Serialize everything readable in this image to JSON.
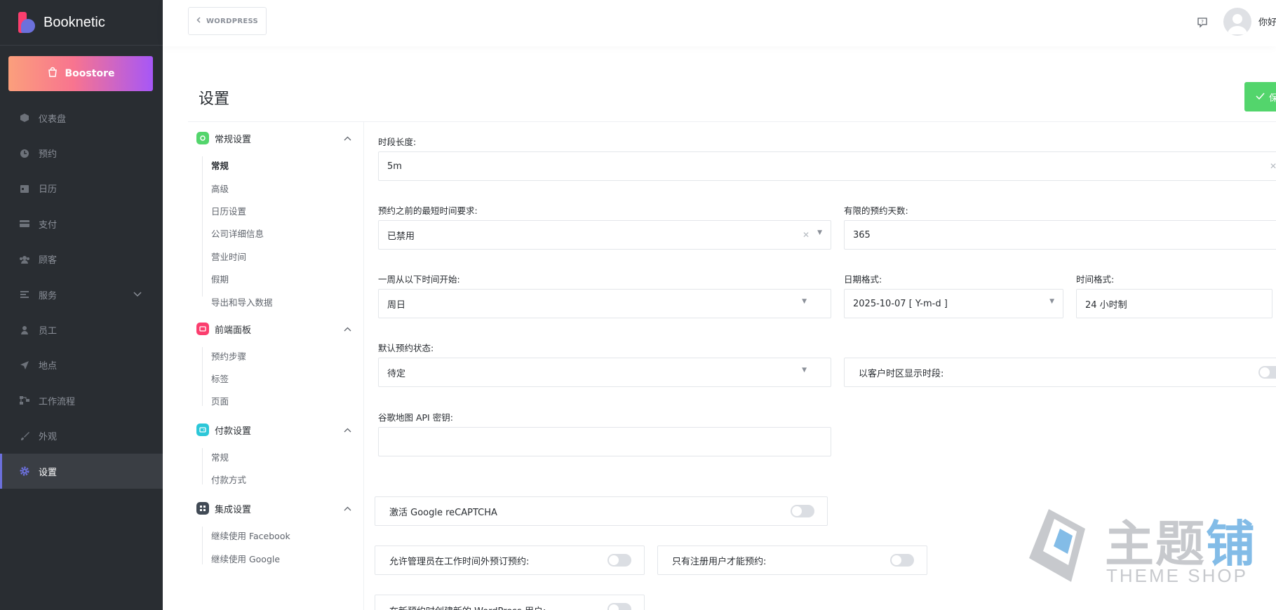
{
  "brand": {
    "name": "Booknetic"
  },
  "sidebar": {
    "boostore_label": "Boostore",
    "items": [
      {
        "label": "仪表盘",
        "icon": "cube-icon"
      },
      {
        "label": "预约",
        "icon": "clock-icon"
      },
      {
        "label": "日历",
        "icon": "calendar-icon"
      },
      {
        "label": "支付",
        "icon": "credit-card-icon"
      },
      {
        "label": "顾客",
        "icon": "users-icon"
      },
      {
        "label": "服务",
        "icon": "list-icon"
      },
      {
        "label": "员工",
        "icon": "user-icon"
      },
      {
        "label": "地点",
        "icon": "location-arrow-icon"
      },
      {
        "label": "工作流程",
        "icon": "workflow-icon"
      },
      {
        "label": "外观",
        "icon": "brush-icon"
      },
      {
        "label": "设置",
        "icon": "gear-icon"
      }
    ]
  },
  "header": {
    "back_label": "WORDPRESS",
    "user_name": "你好"
  },
  "page": {
    "title": "设置",
    "save_label": "保"
  },
  "settings_nav": {
    "groups": [
      {
        "title": "常规设置",
        "color": "#53d56c",
        "links": [
          "常规",
          "高级",
          "日历设置",
          "公司详细信息",
          "营业时间",
          "假期",
          "导出和导入数据"
        ]
      },
      {
        "title": "前端面板",
        "color": "#fb3e6e",
        "links": [
          "预约步骤",
          "标签",
          "页面"
        ]
      },
      {
        "title": "付款设置",
        "color": "#2cc7d8",
        "links": [
          "常规",
          "付款方式"
        ]
      },
      {
        "title": "集成设置",
        "color": "#414a55",
        "links": [
          "继续使用 Facebook",
          "继续使用 Google"
        ]
      }
    ]
  },
  "form": {
    "timeslot_length": {
      "label": "时段长度:",
      "value": "5m"
    },
    "min_time_before": {
      "label": "预约之前的最短时间要求:",
      "value": "已禁用"
    },
    "limited_days": {
      "label": "有限的预约天数:",
      "value": "365"
    },
    "week_starts": {
      "label": "一周从以下时间开始:",
      "value": "周日"
    },
    "date_format": {
      "label": "日期格式:",
      "value": "2025-10-07 [ Y-m-d ]"
    },
    "time_format": {
      "label": "时间格式:",
      "value": "24 小时制"
    },
    "default_status": {
      "label": "默认预约状态:",
      "value": "待定"
    },
    "client_timezone": {
      "label": "以客户时区显示时段:",
      "on": false
    },
    "google_maps_key": {
      "label": "谷歌地图 API 密钥:",
      "value": ""
    },
    "recaptcha": {
      "label": "激活 Google reCAPTCHA",
      "on": false
    },
    "allow_admin_outside": {
      "label": "允许管理员在工作时间外预订预约:",
      "on": false
    },
    "registered_only": {
      "label": "只有注册用户才能预约:",
      "on": false
    },
    "create_wp_user": {
      "label": "在新预约时创建新的 WordPress 用户:",
      "on": false
    }
  },
  "watermark": {
    "text_gray": "主题",
    "text_blue": "铺",
    "sub": "THEME SHOP"
  },
  "colors": {
    "sidebar_bg": "#292d32",
    "accent": "#6c70dc",
    "save": "#53d56c"
  }
}
